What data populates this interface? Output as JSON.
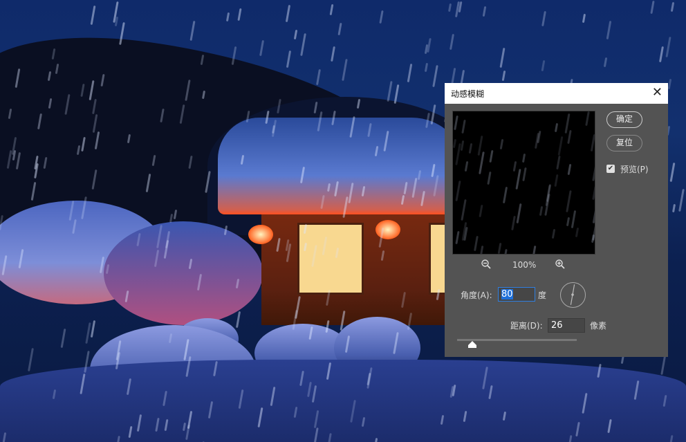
{
  "dialog": {
    "title": "动感模糊",
    "ok_label": "确定",
    "reset_label": "复位",
    "preview_label": "预览(P)",
    "preview_checked": true,
    "zoom_level": "100%",
    "angle_label": "角度(A):",
    "angle_value": "80",
    "angle_unit": "度",
    "distance_label": "距离(D):",
    "distance_value": "26",
    "distance_unit": "像素",
    "distance_slider_fraction": 0.13
  }
}
